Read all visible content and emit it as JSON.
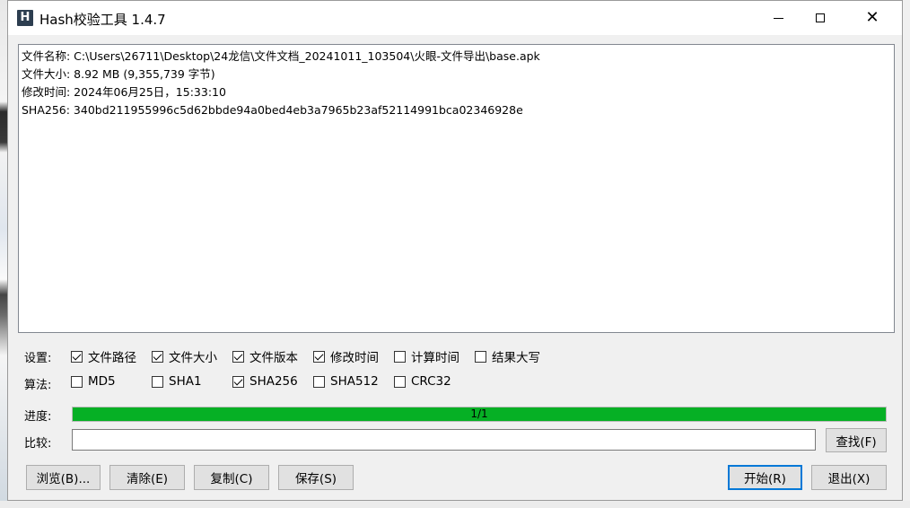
{
  "window": {
    "title": "Hash校验工具 1.4.7",
    "icon_letter": "H"
  },
  "output": {
    "lines": [
      "文件名称: C:\\Users\\26711\\Desktop\\24龙信\\文件文档_20241011_103504\\火眼-文件导出\\base.apk",
      "文件大小: 8.92 MB (9,355,739 字节)",
      "修改时间: 2024年06月25日，15:33:10",
      "SHA256: 340bd211955996c5d62bbde94a0bed4eb3a7965b23af52114991bca02346928e"
    ]
  },
  "settings": {
    "label": "设置:",
    "options": [
      {
        "label": "文件路径",
        "checked": true
      },
      {
        "label": "文件大小",
        "checked": true
      },
      {
        "label": "文件版本",
        "checked": true
      },
      {
        "label": "修改时间",
        "checked": true
      },
      {
        "label": "计算时间",
        "checked": false
      },
      {
        "label": "结果大写",
        "checked": false
      }
    ]
  },
  "algorithms": {
    "label": "算法:",
    "options": [
      {
        "label": "MD5",
        "checked": false
      },
      {
        "label": "SHA1",
        "checked": false
      },
      {
        "label": "SHA256",
        "checked": true
      },
      {
        "label": "SHA512",
        "checked": false
      },
      {
        "label": "CRC32",
        "checked": false
      }
    ]
  },
  "progress": {
    "label": "进度:",
    "text": "1/1",
    "fraction": 1.0,
    "color": "#06b025"
  },
  "compare": {
    "label": "比较:",
    "value": "",
    "find_button": "查找(F)"
  },
  "buttons": {
    "browse": "浏览(B)...",
    "clear": "清除(E)",
    "copy": "复制(C)",
    "save": "保存(S)",
    "start": "开始(R)",
    "exit": "退出(X)"
  }
}
